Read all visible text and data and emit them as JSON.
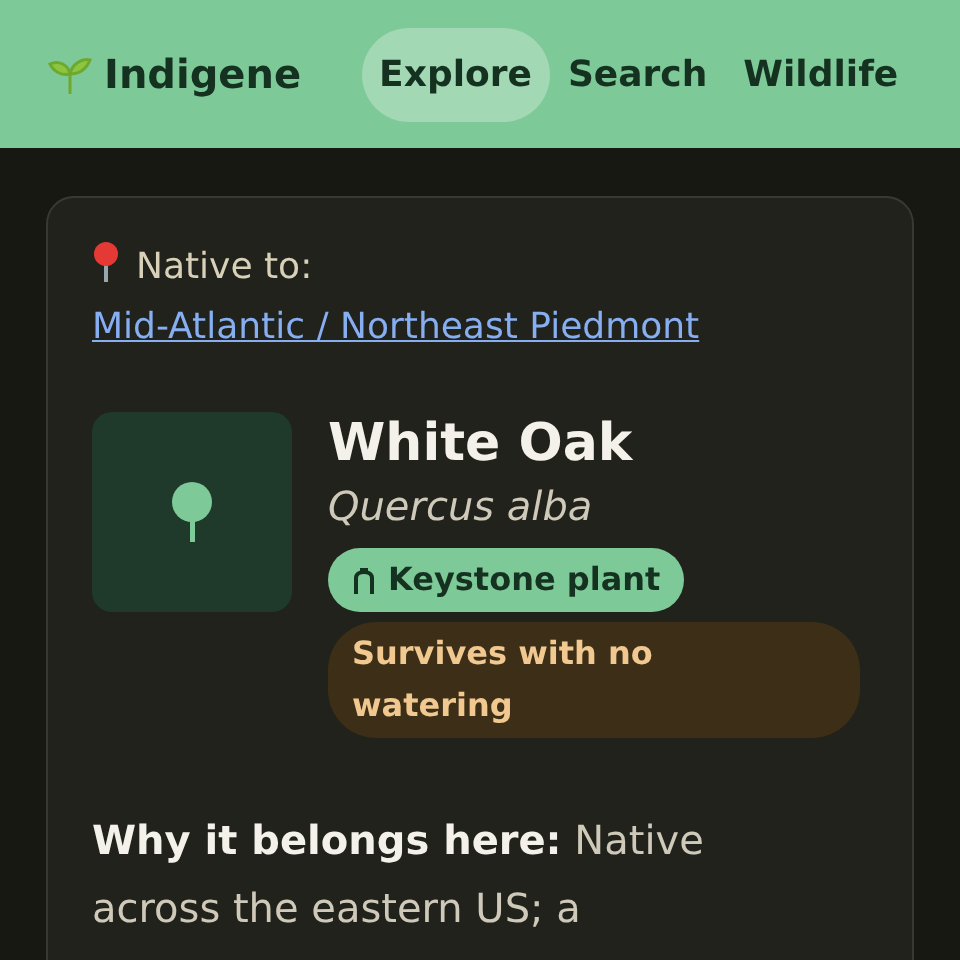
{
  "brand": {
    "name": "Indigene"
  },
  "nav": [
    {
      "label": "Explore",
      "selected": true
    },
    {
      "label": "Search",
      "selected": false
    },
    {
      "label": "Wildlife",
      "selected": false
    }
  ],
  "plant": {
    "native_label": "Native to:",
    "native_region": "Mid-Atlantic / Northeast Piedmont",
    "common_name": "White Oak",
    "scientific_name": "Quercus alba",
    "badges": [
      {
        "kind": "keystone",
        "label": "Keystone plant"
      },
      {
        "kind": "warning",
        "label": "Survives with no watering"
      }
    ],
    "why": "**Why it belongs here:** Native across the eastern US; a"
  }
}
